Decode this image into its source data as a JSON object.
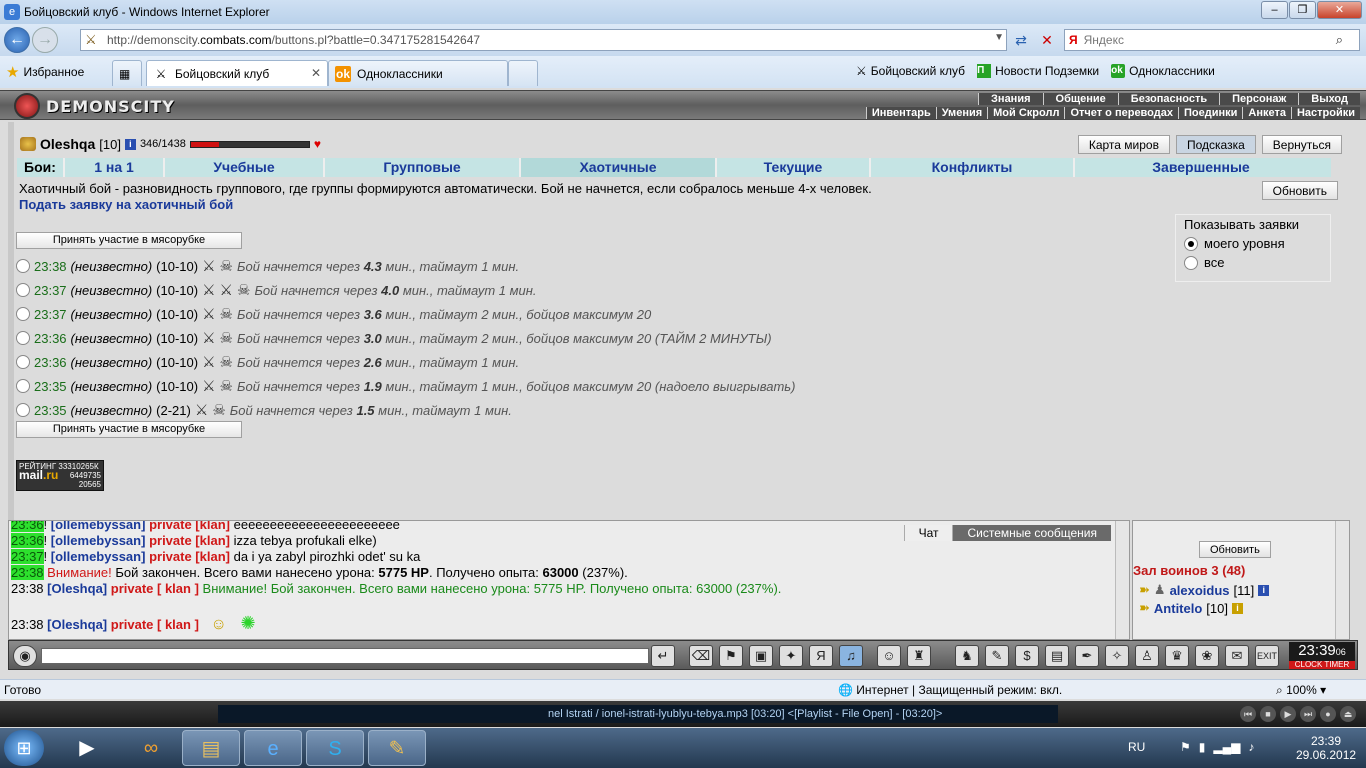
{
  "window": {
    "title": "Бойцовский клуб - Windows Internet Explorer"
  },
  "address": {
    "url_prefix": "http://demonscity.",
    "url_domain": "combats.com",
    "url_suffix": "/buttons.pl?battle=0.347175281542647",
    "search_placeholder": "Яндекс",
    "search_prefix": "Я"
  },
  "favorites": {
    "label": "Избранное",
    "tabs": [
      {
        "label": "Бойцовский клуб"
      },
      {
        "label": "Одноклассники"
      }
    ],
    "links": [
      {
        "label": "Бойцовский клуб"
      },
      {
        "label": "Новости Подземки"
      },
      {
        "label": "Одноклассники"
      }
    ]
  },
  "site": {
    "name": "DEMONSCITY",
    "menu_top": [
      "Знания",
      "Общение",
      "Безопасность",
      "Персонаж",
      "Выход"
    ],
    "menu_bottom": [
      "Инвентарь",
      "Умения",
      "Мой Скролл",
      "Отчет о переводах",
      "Поединки",
      "Анкета",
      "Настройки"
    ]
  },
  "character": {
    "nick": "Oleshqa",
    "level": "[10]",
    "hp": "346/1438",
    "hp_fraction": 0.24
  },
  "top_buttons": {
    "map": "Карта миров",
    "hint": "Подсказка",
    "back": "Вернуться"
  },
  "fight_tabs": {
    "label": "Бои:",
    "items": [
      "1 на 1",
      "Учебные",
      "Групповые",
      "Хаотичные",
      "Текущие",
      "Конфликты",
      "Завершенные"
    ],
    "selected": "Хаотичные"
  },
  "page": {
    "description": "Хаотичный бой - разновидность группового, где группы формируются автоматически. Бой не начнется, если собралось меньше 4-х человек.",
    "apply_link": "Подать заявку на хаотичный бой",
    "refresh": "Обновить",
    "join_button": "Принять участие в мясорубке"
  },
  "show_requests": {
    "title": "Показывать заявки",
    "options": [
      "моего уровня",
      "все"
    ],
    "selected": "моего уровня"
  },
  "fights": [
    {
      "time": "23:38",
      "team": "(неизвестно)",
      "levels": "(10-10)",
      "start_prefix": "Бой начнется через",
      "minutes": "4.3",
      "rest": "мин., таймаут 1 мин."
    },
    {
      "time": "23:37",
      "team": "(неизвестно)",
      "levels": "(10-10)",
      "start_prefix": "Бой начнется через",
      "minutes": "4.0",
      "rest": "мин., таймаут 1 мин."
    },
    {
      "time": "23:37",
      "team": "(неизвестно)",
      "levels": "(10-10)",
      "start_prefix": "Бой начнется через",
      "minutes": "3.6",
      "rest": "мин., таймаут 2 мин., бойцов максимум 20"
    },
    {
      "time": "23:36",
      "team": "(неизвестно)",
      "levels": "(10-10)",
      "start_prefix": "Бой начнется через",
      "minutes": "3.0",
      "rest": "мин., таймаут 2 мин., бойцов максимум 20 (ТАЙМ 2 МИНУТЫ)"
    },
    {
      "time": "23:36",
      "team": "(неизвестно)",
      "levels": "(10-10)",
      "start_prefix": "Бой начнется через",
      "minutes": "2.6",
      "rest": "мин., таймаут 1 мин."
    },
    {
      "time": "23:35",
      "team": "(неизвестно)",
      "levels": "(10-10)",
      "start_prefix": "Бой начнется через",
      "minutes": "1.9",
      "rest": "мин., таймаут 1 мин., бойцов максимум 20 (надоело выигрывать)"
    },
    {
      "time": "23:35",
      "team": "(неизвестно)",
      "levels": "(2-21)",
      "start_prefix": "Бой начнется через",
      "minutes": "1.5",
      "rest": "мин., таймаут 1 мин."
    }
  ],
  "counter": {
    "line1": "РЕЙТИНГ 33310265К",
    "line2": "6449735",
    "line3": "20565",
    "brand": "mail",
    "brand_tld": ".ru"
  },
  "chat": {
    "tabs": [
      "Чат",
      "Системные сообщения"
    ],
    "lines": [
      {
        "time": "23:36",
        "nick": "[ollemebyssan]",
        "private": "private [klan]",
        "text": "eeeeeeeeeeeeeeeeeeeeeee"
      },
      {
        "time": "23:36",
        "nick": "[ollemebyssan]",
        "private": "private [klan]",
        "text": "izza tebya profukali elke)"
      },
      {
        "time": "23:37",
        "nick": "[ollemebyssan]",
        "private": "private [klan]",
        "text": "da i ya zabyl pirozhki odet' su ka"
      }
    ],
    "system": {
      "time": "23:38",
      "attention": "Внимание!",
      "text1": "Бой закончен. Всего вами нанесено урона:",
      "damage": "5775 HP",
      "text2": ". Получено опыта:",
      "exp": "63000",
      "pct": "(237%)."
    },
    "self1": {
      "time": "23:38",
      "nick": "[Oleshqa]",
      "private": "private [ klan ]",
      "text": "Внимание! Бой закончен. Всего вами нанесено урона: 5775 HP. Получено опыта: 63000 (237%)."
    },
    "self2": {
      "time": "23:38",
      "nick": "[Oleshqa]",
      "private": "private [ klan ]"
    }
  },
  "online": {
    "refresh": "Обновить",
    "hall": "Зал воинов 3 (48)",
    "users": [
      {
        "nick": "alexoidus",
        "level": "[11]"
      },
      {
        "nick": "Antitelo",
        "level": "[10]"
      }
    ]
  },
  "clock": {
    "time": "23:39",
    "sec": "06",
    "label": "CLOCK TIMER"
  },
  "status": {
    "left": "Готово",
    "zone": "Интернет | Защищенный режим: вкл.",
    "zoom": "100%"
  },
  "player": {
    "track": "nel Istrati / ionel-istrati-lyublyu-tebya.mp3  [03:20]    <[Playlist - File Open] - [03:20]>"
  },
  "taskbar": {
    "lang": "RU",
    "time": "23:39",
    "date": "29.06.2012"
  },
  "colors": {
    "link": "#1a3a9a",
    "tabs_bg": "#c5e4e4",
    "alert": "#d01818",
    "chat_time_bg": "#2de02d"
  }
}
